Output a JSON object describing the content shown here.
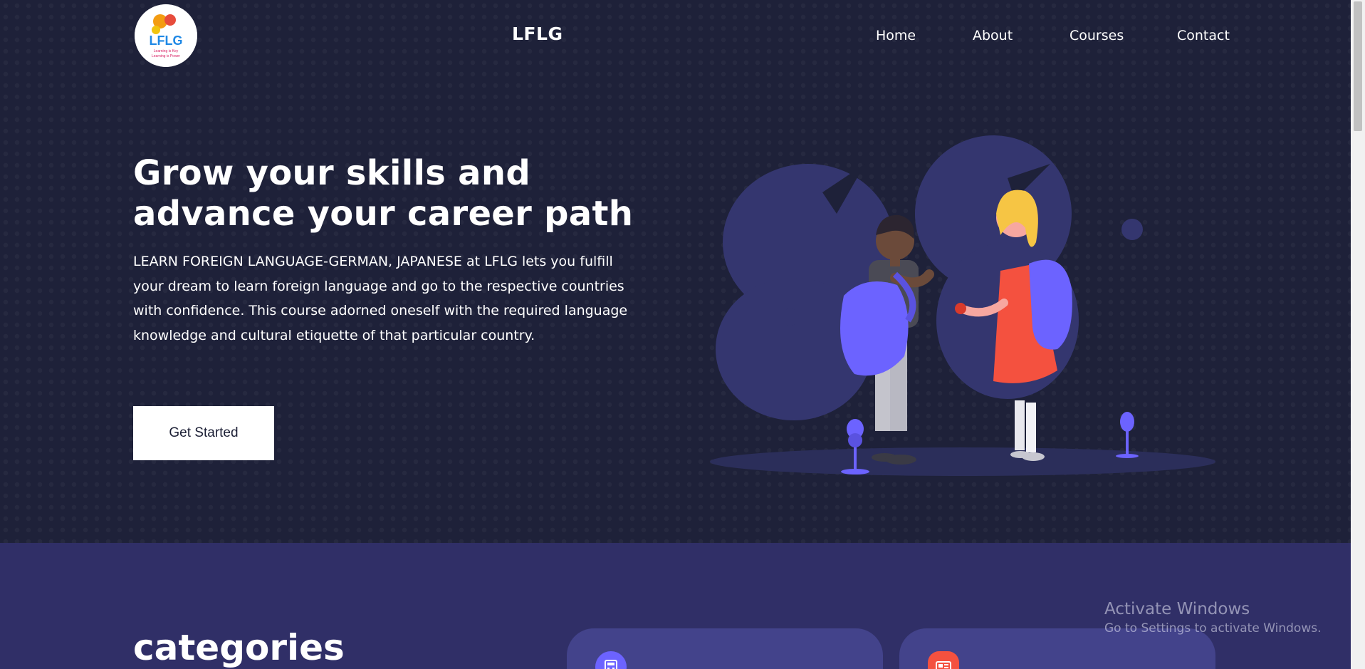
{
  "nav": {
    "brand": "LFLG",
    "logo_text": "LFLG",
    "logo_tagline_1": "Learning is Key",
    "logo_tagline_2": "Learning is Power",
    "links": [
      {
        "label": "Home",
        "icon": null
      },
      {
        "label": "About",
        "icon": null
      },
      {
        "label": "Courses",
        "icon": null
      },
      {
        "label": "Contact",
        "icon": null
      }
    ]
  },
  "hero": {
    "title_line_1": "Grow your skills and",
    "title_line_2": "advance your career path",
    "description": "LEARN FOREIGN LANGUAGE-GERMAN, JAPANESE at LFLG lets you fulfill your dream to learn foreign language and go to the respective countries with confidence. This course adorned oneself with the required language knowledge and cultural etiquette of that particular country.",
    "cta_label": "Get Started"
  },
  "categories": {
    "title": "categories",
    "cards": [
      {
        "icon": "calculator-icon",
        "icon_color": "#6c63ff"
      },
      {
        "icon": "news-icon",
        "icon_color": "#f4513f"
      }
    ]
  },
  "os_overlay": {
    "line1": "Activate Windows",
    "line2": "Go to Settings to activate Windows."
  },
  "colors": {
    "hero_bg": "#1e2139",
    "section_bg": "#302f67",
    "accent": "#6c63ff",
    "card_bg": "#43438b"
  }
}
